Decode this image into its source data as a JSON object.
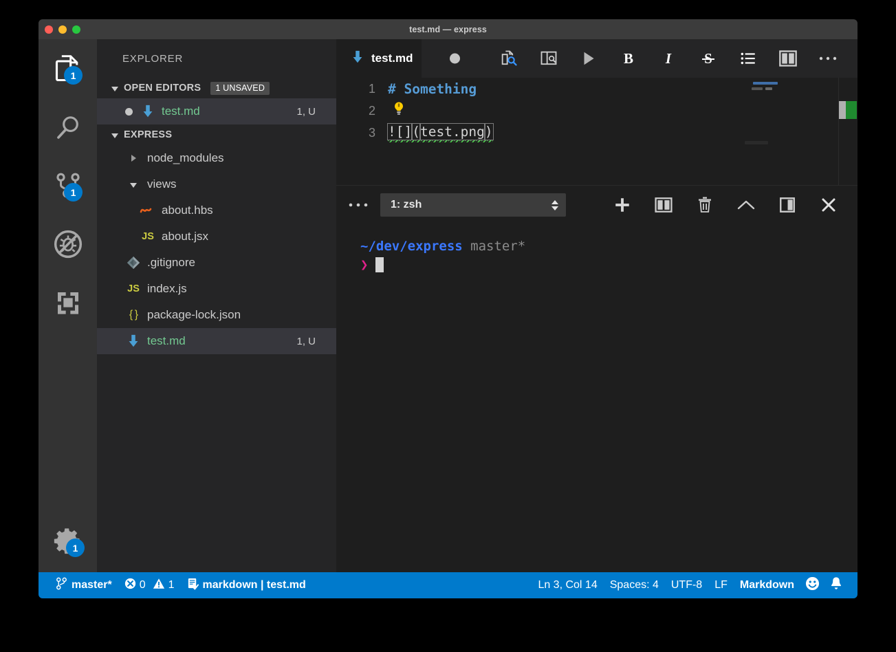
{
  "window": {
    "title": "test.md — express",
    "traffic_lights": [
      "close",
      "minimize",
      "zoom"
    ]
  },
  "activity_bar": {
    "items": [
      {
        "name": "explorer",
        "icon": "files-icon",
        "badge": "1",
        "active": true
      },
      {
        "name": "search",
        "icon": "search-icon",
        "badge": null,
        "active": false
      },
      {
        "name": "source-control",
        "icon": "source-control-icon",
        "badge": "1",
        "active": false
      },
      {
        "name": "debug",
        "icon": "debug-no-icon",
        "badge": null,
        "active": false
      },
      {
        "name": "extensions",
        "icon": "extensions-icon",
        "badge": null,
        "active": false
      }
    ],
    "settings": {
      "name": "manage",
      "icon": "gear-icon",
      "badge": "1"
    }
  },
  "sidebar": {
    "title": "EXPLORER",
    "sections": [
      {
        "header": "OPEN EDITORS",
        "badge": "1 UNSAVED",
        "expanded": true
      },
      {
        "header": "EXPRESS",
        "badge": null,
        "expanded": true
      }
    ],
    "open_editors": [
      {
        "label": "test.md",
        "icon": "markdown-icon",
        "dirty": true,
        "meta": "1, U",
        "selected": true,
        "green": true
      }
    ],
    "files": [
      {
        "label": "node_modules",
        "icon": "folder-collapsed",
        "indent": 1,
        "meta": "",
        "selected": false,
        "green": false
      },
      {
        "label": "views",
        "icon": "folder-expanded",
        "indent": 1,
        "meta": "",
        "selected": false,
        "green": false
      },
      {
        "label": "about.hbs",
        "icon": "handlebars-icon",
        "indent": 2,
        "meta": "",
        "selected": false,
        "green": false
      },
      {
        "label": "about.jsx",
        "icon": "js-icon",
        "indent": 2,
        "meta": "",
        "selected": false,
        "green": false
      },
      {
        "label": ".gitignore",
        "icon": "git-icon",
        "indent": 1,
        "meta": "",
        "selected": false,
        "green": false
      },
      {
        "label": "index.js",
        "icon": "js-icon",
        "indent": 1,
        "meta": "",
        "selected": false,
        "green": false
      },
      {
        "label": "package-lock.json",
        "icon": "json-icon",
        "indent": 1,
        "meta": "",
        "selected": false,
        "green": false
      },
      {
        "label": "test.md",
        "icon": "markdown-icon",
        "indent": 1,
        "meta": "1, U",
        "selected": true,
        "green": true
      }
    ]
  },
  "editor": {
    "tab": {
      "label": "test.md",
      "icon": "markdown-icon",
      "dirty": true
    },
    "actions": [
      {
        "name": "open-preview",
        "icon": "preview-icon",
        "label": ""
      },
      {
        "name": "open-preview-to-side",
        "icon": "preview-side-icon",
        "label": ""
      },
      {
        "name": "run-code",
        "icon": "play-icon",
        "label": ""
      },
      {
        "name": "bold",
        "icon": "bold-icon",
        "label": "B"
      },
      {
        "name": "italic",
        "icon": "italic-icon",
        "label": "I"
      },
      {
        "name": "strikethrough",
        "icon": "strikethrough-icon",
        "label": "S"
      },
      {
        "name": "bullet-list",
        "icon": "list-icon",
        "label": ""
      },
      {
        "name": "split-editor",
        "icon": "split-editor-icon",
        "label": ""
      },
      {
        "name": "more-actions",
        "icon": "ellipsis-icon",
        "label": ""
      }
    ],
    "lines": [
      {
        "number": "1",
        "text": "# Something",
        "kind": "heading"
      },
      {
        "number": "2",
        "text": "",
        "kind": "lightbulb"
      },
      {
        "number": "3",
        "text": "![](test.png)",
        "kind": "image-link"
      }
    ],
    "code_line3": {
      "prefix": "![]",
      "open_paren": "(",
      "link": "test.png",
      "close_paren": ")"
    }
  },
  "panel": {
    "more_label": "•••",
    "terminal_select": "1: zsh",
    "actions": [
      {
        "name": "new-terminal",
        "icon": "plus-icon"
      },
      {
        "name": "split-terminal",
        "icon": "split-icon"
      },
      {
        "name": "kill-terminal",
        "icon": "trash-icon"
      },
      {
        "name": "maximize-panel",
        "icon": "chevron-up-icon"
      },
      {
        "name": "toggle-panel-position",
        "icon": "panel-layout-icon"
      },
      {
        "name": "close-panel",
        "icon": "close-icon"
      }
    ],
    "terminal": {
      "path": "~/dev/express",
      "branch": "master*",
      "prompt": "❯",
      "input": ""
    }
  },
  "status_bar": {
    "left": [
      {
        "name": "branch",
        "icon": "git-branch-icon",
        "text": "master*"
      },
      {
        "name": "problems",
        "icon": "error-warning-icon",
        "text": "0   1",
        "errors": "0",
        "warnings": "1"
      },
      {
        "name": "spell-checker",
        "icon": "spell-check-icon",
        "text": "markdown | test.md"
      }
    ],
    "right": [
      {
        "name": "cursor-position",
        "text": "Ln 3, Col 14"
      },
      {
        "name": "indentation",
        "text": "Spaces: 4"
      },
      {
        "name": "encoding",
        "text": "UTF-8"
      },
      {
        "name": "eol",
        "text": "LF"
      },
      {
        "name": "language-mode",
        "text": "Markdown"
      },
      {
        "name": "feedback",
        "icon": "smiley-icon",
        "text": ""
      },
      {
        "name": "notifications",
        "icon": "bell-icon",
        "text": ""
      }
    ]
  },
  "colors": {
    "accent": "#007acc",
    "titlebar": "#3c3c3c",
    "activitybar": "#333333",
    "sidebar": "#252526",
    "editor": "#1e1e1e",
    "selected_row": "#37373d",
    "green_text": "#73c991",
    "heading_blue": "#569cd6",
    "terminal_path": "#3b78ff",
    "terminal_arrow": "#e0218a"
  }
}
